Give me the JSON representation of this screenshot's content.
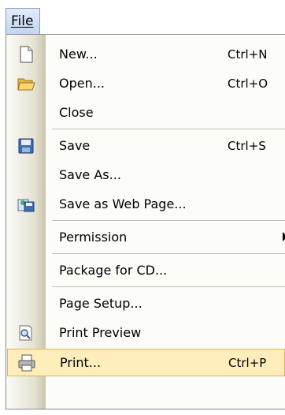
{
  "menubar": {
    "file": "File"
  },
  "menu": {
    "items": [
      {
        "label": "New...",
        "shortcut": "Ctrl+N",
        "icon": "new-document-icon"
      },
      {
        "label": "Open...",
        "shortcut": "Ctrl+O",
        "icon": "open-folder-icon"
      },
      {
        "label": "Close",
        "shortcut": "",
        "icon": ""
      },
      {
        "label": "Save",
        "shortcut": "Ctrl+S",
        "icon": "save-disk-icon"
      },
      {
        "label": "Save As...",
        "shortcut": "",
        "icon": ""
      },
      {
        "label": "Save as Web Page...",
        "shortcut": "",
        "icon": "save-web-page-icon"
      },
      {
        "label": "Permission",
        "shortcut": "",
        "icon": "",
        "submenu": true
      },
      {
        "label": "Package for CD...",
        "shortcut": "",
        "icon": ""
      },
      {
        "label": "Page Setup...",
        "shortcut": "",
        "icon": ""
      },
      {
        "label": "Print Preview",
        "shortcut": "",
        "icon": "print-preview-icon"
      },
      {
        "label": "Print...",
        "shortcut": "Ctrl+P",
        "icon": "printer-icon",
        "highlighted": true
      }
    ]
  },
  "colors": {
    "highlight_bg": "#ffeebb",
    "highlight_border": "#d8b75c",
    "gutter": "#e6e3d3"
  }
}
